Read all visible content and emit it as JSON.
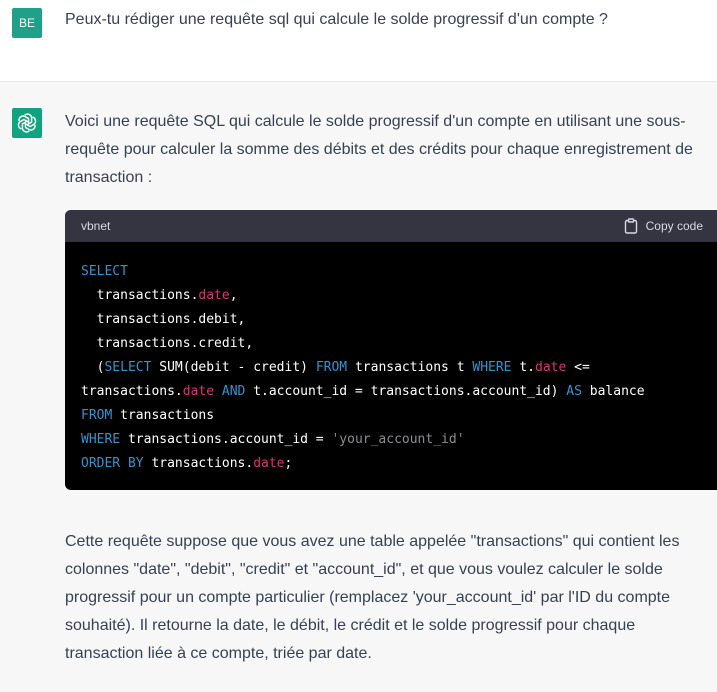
{
  "user": {
    "avatar_initials": "BE",
    "avatar_color": "#1fa189",
    "message": "Peux-tu rédiger une requête sql qui calcule le solde progressif d'un compte ?"
  },
  "assistant": {
    "avatar_icon": "openai-logo-icon",
    "avatar_color": "#10a37f",
    "intro": "Voici une requête SQL qui calcule le solde progressif d'un compte en utilisant une sous-requête pour calculer la somme des débits et des crédits pour chaque enregistrement de transaction :",
    "code": {
      "language": "vbnet",
      "copy_label": "Copy code",
      "copy_icon": "clipboard-icon",
      "tokens": {
        "select": "SELECT",
        "l2a": "  transactions.",
        "l2b": "date",
        "l2c": ",",
        "l3": "  transactions.debit,",
        "l4": "  transactions.credit,",
        "l5a": "  (",
        "l5b": "SELECT",
        "l5c": " SUM(debit - credit) ",
        "l5d": "FROM",
        "l5e": " transactions t ",
        "l5f": "WHERE",
        "l5g": " t.",
        "l5h": "date",
        "l5i": " <=",
        "l6a": "transactions.",
        "l6b": "date",
        "l6c": " ",
        "l6d": "AND",
        "l6e": " t.account_id = transactions.account_id) ",
        "l6f": "AS",
        "l6g": " balance",
        "l7a": "FROM",
        "l7b": " transactions",
        "l8a": "WHERE",
        "l8b": " transactions.account_id = ",
        "l8c": "'your_account_id'",
        "l9a": "ORDER BY",
        "l9b": " transactions.",
        "l9c": "date",
        "l9d": ";"
      }
    },
    "outro": "Cette requête suppose que vous avez une table appelée \"transactions\" qui contient les colonnes \"date\", \"debit\", \"credit\" et \"account_id\", et que vous voulez calculer le solde progressif pour un compte particulier (remplacez 'your_account_id' par l'ID du compte souhaité). Il retourne la date, le débit, le crédit et le solde progressif pour chaque transaction liée à ce compte, triée par date."
  }
}
